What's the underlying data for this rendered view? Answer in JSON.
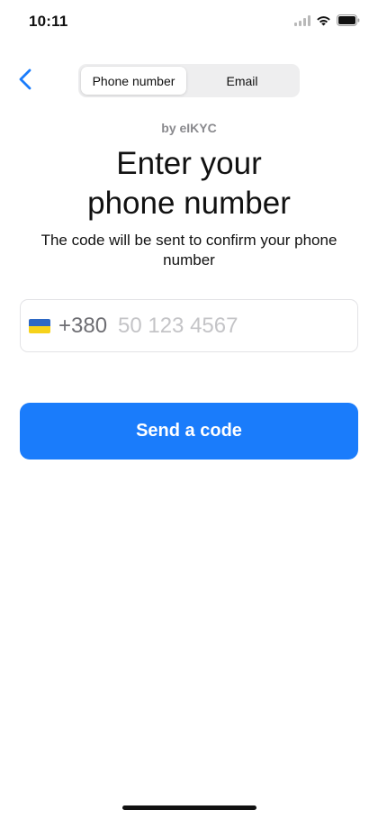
{
  "status_bar": {
    "time": "10:11",
    "icons": [
      "signal-icon",
      "wifi-icon",
      "battery-icon"
    ]
  },
  "nav": {
    "back_icon": "chevron-left-icon",
    "accent_color": "#1a7cfb"
  },
  "segmented_control": {
    "options": [
      {
        "label": "Phone number",
        "selected": true
      },
      {
        "label": "Email",
        "selected": false
      }
    ]
  },
  "header": {
    "by_label": "by eIKYC",
    "title": "Enter your phone number",
    "subtitle": "The code will be sent to confirm your phone number"
  },
  "phone_field": {
    "flag_icon": "ukraine-flag-icon",
    "country_code": "+380",
    "value": "",
    "placeholder": "50 123 4567"
  },
  "send_button": {
    "label": "Send a code",
    "color": "#1a7cfb"
  }
}
